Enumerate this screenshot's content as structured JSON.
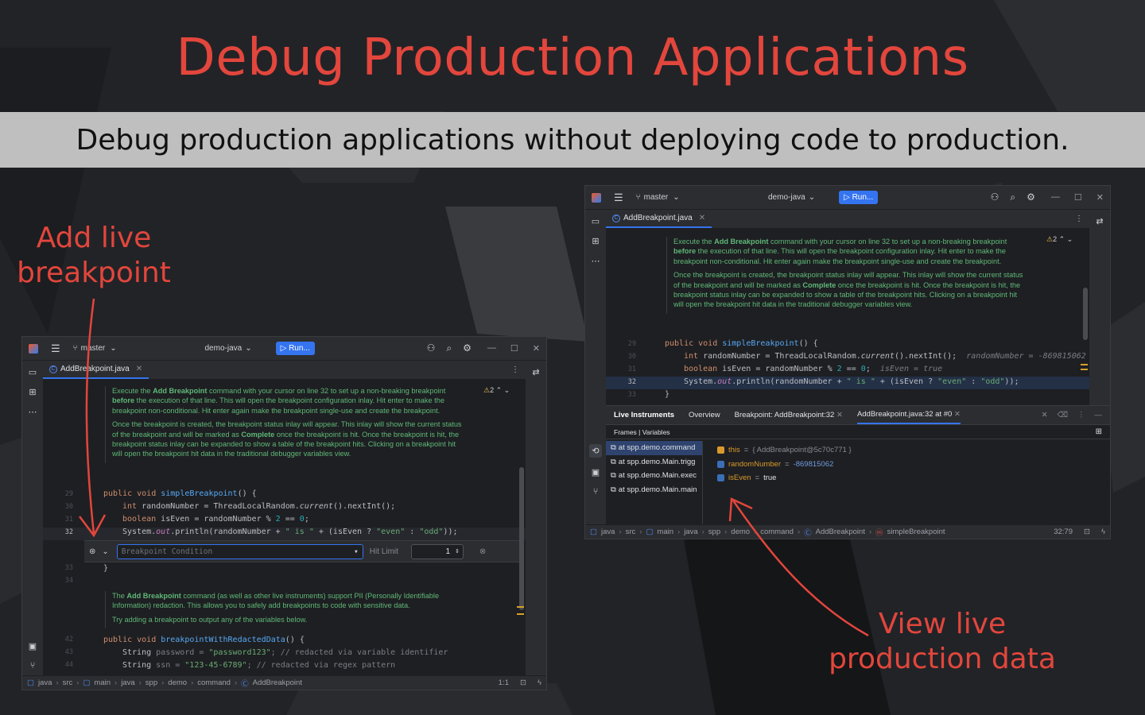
{
  "header": {
    "title": "Debug Production Applications",
    "subtitle": "Debug production applications without deploying code to production."
  },
  "callouts": {
    "add_live_line1": "Add live",
    "add_live_line2": "breakpoint",
    "view_live_line1": "View live",
    "view_live_line2": "production data"
  },
  "colors": {
    "accent": "#e2463c",
    "run_button": "#3574f0",
    "doc_text": "#5fb878"
  },
  "left_ide": {
    "branch": "master",
    "project": "demo-java",
    "run_label": "Run...",
    "tab": "AddBreakpoint.java",
    "warnings": "2",
    "doc1": {
      "p1_a": "Execute the ",
      "p1_b": "Add Breakpoint",
      "p1_c": " command with your cursor on line 32 to set up a non-breaking breakpoint ",
      "p1_d": "before",
      "p1_e": " the execution of that line. This will open the breakpoint configuration inlay. Hit enter to make the breakpoint non-conditional. Hit enter again make the breakpoint single-use and create the breakpoint.",
      "p2_a": "Once the breakpoint is created, the breakpoint status inlay will appear. This inlay will show the current status of the breakpoint and will be marked as ",
      "p2_b": "Complete",
      "p2_c": " once the breakpoint is hit. Once the breakpoint is hit, the breakpoint status inlay can be expanded to show a table of the breakpoint hits. Clicking on a breakpoint hit will open the breakpoint hit data in the traditional debugger variables view."
    },
    "line_numbers": [
      "29",
      "30",
      "31",
      "32",
      "33",
      "34",
      "42",
      "43",
      "44"
    ],
    "code": {
      "l29_kw": "public void ",
      "l29_fn": "simpleBreakpoint",
      "l29_rest": "() {",
      "l30_kw": "int ",
      "l30_a": "randomNumber = ThreadLocalRandom.",
      "l30_it": "current",
      "l30_b": "().nextInt();",
      "l31_kw": "boolean ",
      "l31_a": "isEven = randomNumber % ",
      "l31_n1": "2",
      "l31_b": " == ",
      "l31_n2": "0",
      "l31_c": ";",
      "l32_a": "System.",
      "l32_fld": "out",
      "l32_b": ".println(randomNumber + ",
      "l32_s1": "\" is \"",
      "l32_c": " + (isEven ? ",
      "l32_s2": "\"even\"",
      "l32_d": " : ",
      "l32_s3": "\"odd\"",
      "l32_e": "));",
      "l33": "}",
      "l42_kw": "public void ",
      "l42_fn": "breakpointWithRedactedData",
      "l42_rest": "() {",
      "l43_a": "String ",
      "l43_b": "password = ",
      "l43_s": "\"password123\"",
      "l43_cm": "; // redacted via variable identifier",
      "l44_a": "String ",
      "l44_b": "ssn = ",
      "l44_s": "\"123-45-6789\"",
      "l44_cm": "; // redacted via regex pattern"
    },
    "doc2": {
      "p1_a": "The ",
      "p1_b": "Add Breakpoint",
      "p1_c": " command (as well as other live instruments) support PII (Personally Identifiable Information) redaction. This allows you to safely add breakpoints to code with sensitive data.",
      "p2": "Try adding a breakpoint to output any of the variables below."
    },
    "bp_inlay": {
      "condition_placeholder": "Breakpoint Condition",
      "hit_limit_label": "Hit Limit",
      "hit_limit_value": "1"
    },
    "breadcrumb": [
      "java",
      "src",
      "main",
      "java",
      "spp",
      "demo",
      "command",
      "AddBreakpoint"
    ],
    "position": "1:1"
  },
  "right_ide": {
    "branch": "master",
    "project": "demo-java",
    "run_label": "Run...",
    "tab": "AddBreakpoint.java",
    "warnings": "2",
    "line_numbers": [
      "29",
      "30",
      "31",
      "32",
      "33"
    ],
    "hint30": "randomNumber = -869815062",
    "hint31": "isEven = true",
    "panel": {
      "title": "Live Instruments",
      "tabs": [
        "Overview",
        "Breakpoint: AddBreakpoint:32",
        "AddBreakpoint.java:32 at #0"
      ],
      "subtabs": "Frames | Variables",
      "frames": [
        "at spp.demo.command",
        "at spp.demo.Main.trigg",
        "at spp.demo.Main.exec",
        "at spp.demo.Main.main"
      ],
      "variables": [
        {
          "name": "this",
          "eq": " = ",
          "value": "{ AddBreakpoint@5c70c771 }"
        },
        {
          "name": "randomNumber",
          "eq": " = ",
          "value": "-869815062"
        },
        {
          "name": "isEven",
          "eq": " = ",
          "value": "true"
        }
      ]
    },
    "breadcrumb": [
      "java",
      "src",
      "main",
      "java",
      "spp",
      "demo",
      "command",
      "AddBreakpoint",
      "simpleBreakpoint"
    ],
    "position": "32:79"
  }
}
